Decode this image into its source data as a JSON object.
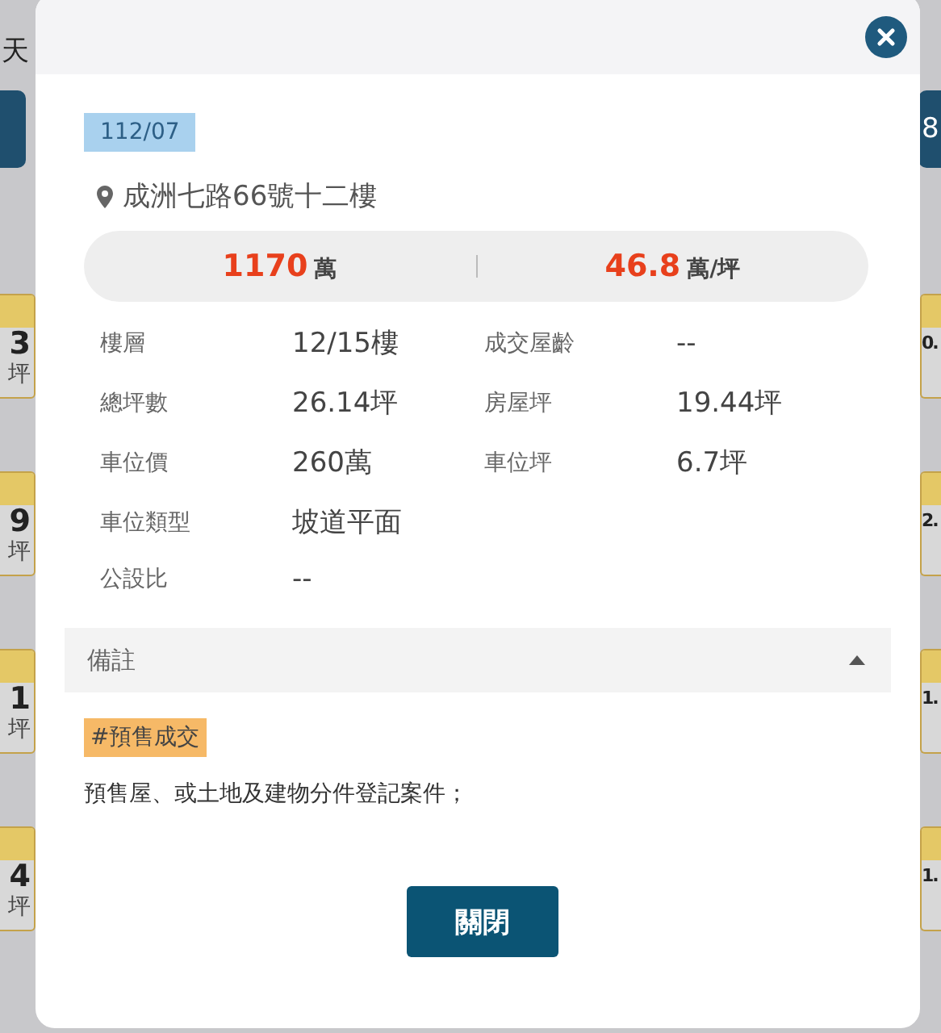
{
  "background": {
    "title_fragment": "天",
    "button_fragment": "8",
    "left_cards": [
      {
        "value": "3",
        "unit": "坪"
      },
      {
        "value": "9",
        "unit": "坪"
      },
      {
        "value": "1",
        "unit": "坪"
      },
      {
        "value": "4",
        "unit": "坪"
      }
    ],
    "right_cards": [
      {
        "value": "0."
      },
      {
        "value": "2."
      },
      {
        "value": "1."
      },
      {
        "value": "1."
      }
    ]
  },
  "modal": {
    "date_tag": "112/07",
    "address": "成洲七路66號十二樓",
    "price": {
      "total": "1170",
      "total_unit": "萬",
      "unit_price": "46.8",
      "unit_price_unit": "萬/坪"
    },
    "details": [
      [
        {
          "label": "樓層",
          "value": "12/15樓"
        },
        {
          "label": "成交屋齡",
          "value": "--"
        }
      ],
      [
        {
          "label": "總坪數",
          "value": "26.14坪"
        },
        {
          "label": "房屋坪",
          "value": "19.44坪"
        }
      ],
      [
        {
          "label": "車位價",
          "value": "260萬"
        },
        {
          "label": "車位坪",
          "value": "6.7坪"
        }
      ],
      [
        {
          "label": "車位類型",
          "value": "坡道平面"
        }
      ],
      [
        {
          "label": "公設比",
          "value": "--"
        }
      ]
    ],
    "note": {
      "title": "備註",
      "expanded": true,
      "tags": [
        "#預售成交"
      ],
      "text": "預售屋、或土地及建物分件登記案件；"
    },
    "close_button": "關閉"
  }
}
